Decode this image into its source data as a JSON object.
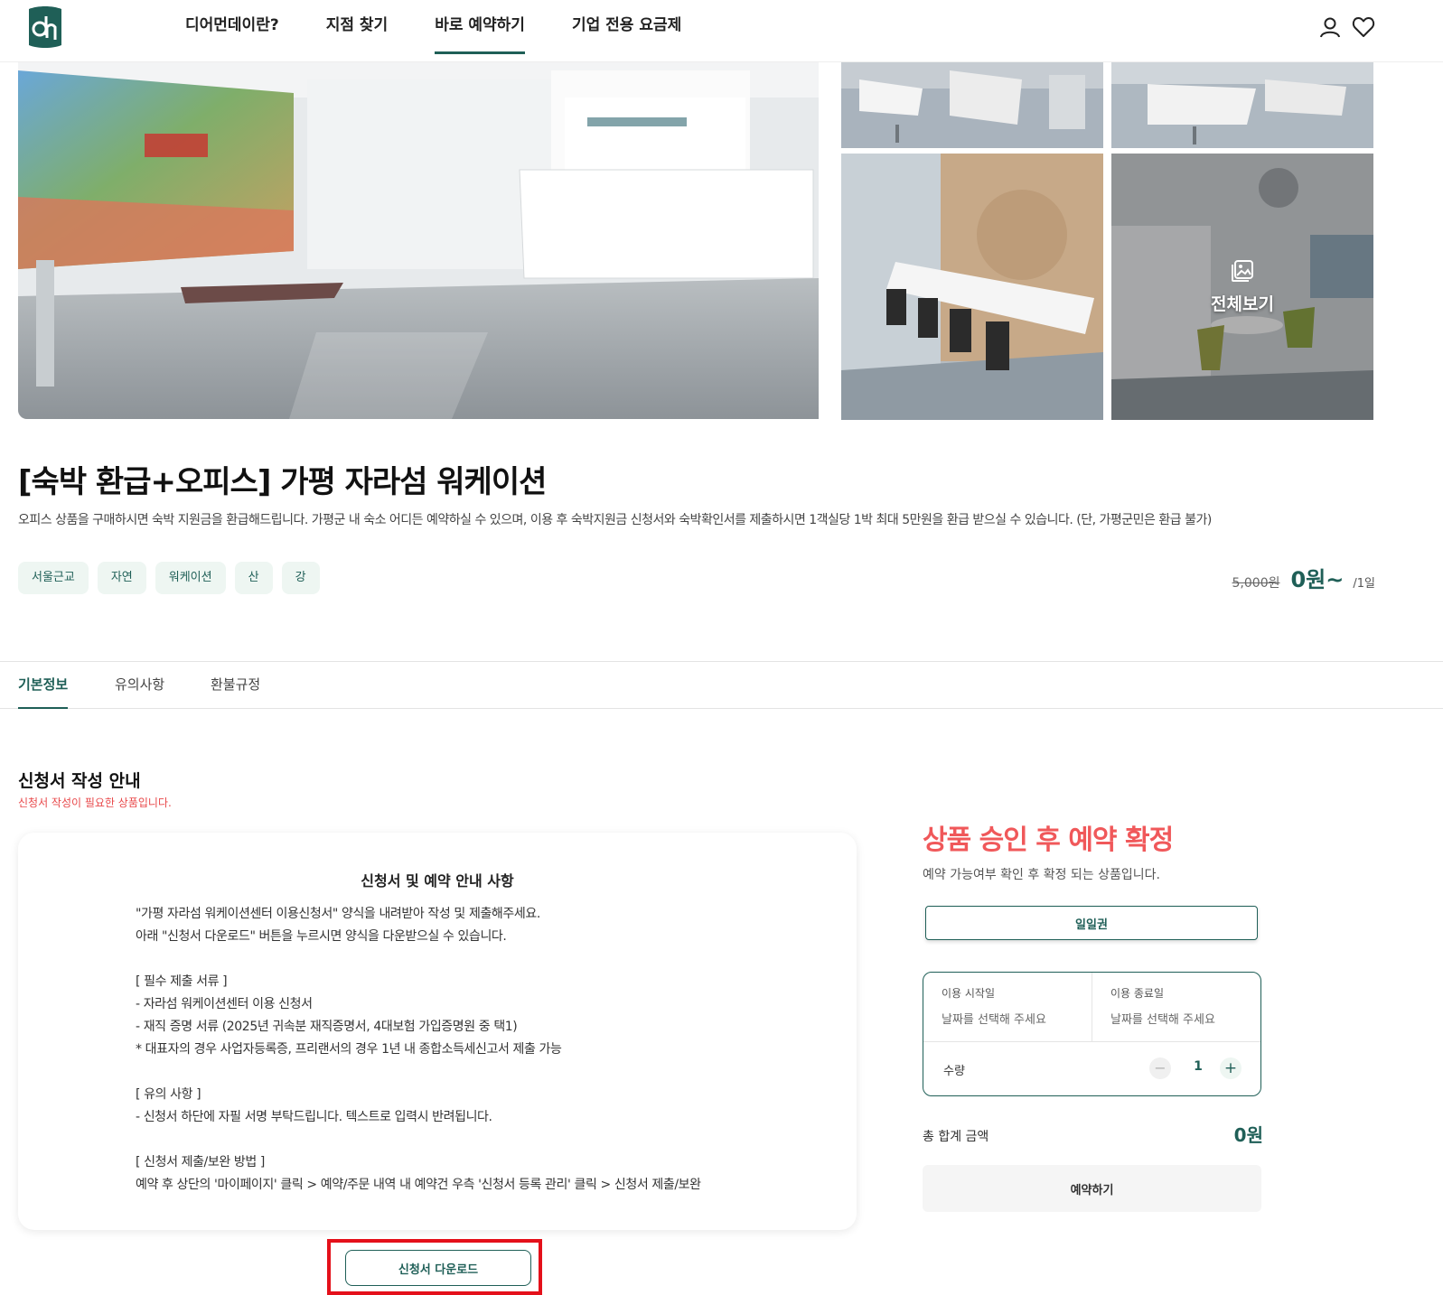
{
  "header": {
    "nav": [
      "디어먼데이란?",
      "지점 찾기",
      "바로 예약하기",
      "기업 전용 요금제"
    ],
    "active_nav": "바로 예약하기",
    "icons": [
      "user-icon",
      "heart-icon"
    ]
  },
  "gallery": {
    "view_all_label": "전체보기"
  },
  "product": {
    "title": "[숙박 환급+오피스] 가평 자라섬 워케이션",
    "description": "오피스 상품을 구매하시면 숙박 지원금을 환급해드립니다. 가평군 내 숙소 어디든 예약하실 수 있으며, 이용 후 숙박지원금 신청서와 숙박확인서를 제출하시면 1객실당 1박 최대 5만원을 환급 받으실 수 있습니다. (단, 가평군민은 환급 불가)",
    "tags": [
      "서울근교",
      "자연",
      "워케이션",
      "산",
      "강"
    ],
    "price_original": "5,000원",
    "price_current": "0원~",
    "price_unit": "/1일"
  },
  "tabs": [
    "기본정보",
    "유의사항",
    "환불규정"
  ],
  "guide": {
    "title": "신청서 작성 안내",
    "subtitle": "신청서 작성이 필요한 상품입니다.",
    "card_heading": "신청서 및 예약 안내 사항",
    "lines": [
      "\"가평 자라섬 워케이션센터 이용신청서\" 양식을 내려받아 작성 및 제출해주세요.",
      "아래 \"신청서 다운로드\" 버튼을 누르시면 양식을 다운받으실 수 있습니다.",
      "",
      "[ 필수 제출 서류 ]",
      "- 자라섬 워케이션센터 이용 신청서",
      "- 재직 증명 서류 (2025년 귀속분 재직증명서, 4대보험 가입증명원 중 택1)",
      "* 대표자의 경우 사업자등록증, 프리랜서의 경우 1년 내 종합소득세신고서 제출 가능",
      "",
      "[ 유의 사항 ]",
      "- 신청서 하단에 자필 서명 부탁드립니다. 텍스트로 입력시 반려됩니다.",
      "",
      "[ 신청서 제출/보완 방법 ]",
      "예약 후 상단의 '마이페이지' 클릭 > 예약/주문 내역 내 예약건 우측 '신청서 등록 관리' 클릭 > 신청서 제출/보완"
    ],
    "download_label": "신청서 다운로드"
  },
  "booking": {
    "headline": "상품 승인 후 예약 확정",
    "subline": "예약 가능여부 확인 후 확정 되는 상품입니다.",
    "pass_label": "일일권",
    "start_label": "이용 시작일",
    "end_label": "이용 종료일",
    "date_placeholder": "날짜를 선택해 주세요",
    "qty_label": "수량",
    "qty_value": "1",
    "minus": "−",
    "plus": "+",
    "total_label": "총 합계 금액",
    "total_value": "0원",
    "reserve_label": "예약하기"
  },
  "colors": {
    "brand": "#1f5f57",
    "alert": "#f0585a",
    "highlight_box": "#e4101a",
    "tag_bg": "#eef6f2"
  }
}
